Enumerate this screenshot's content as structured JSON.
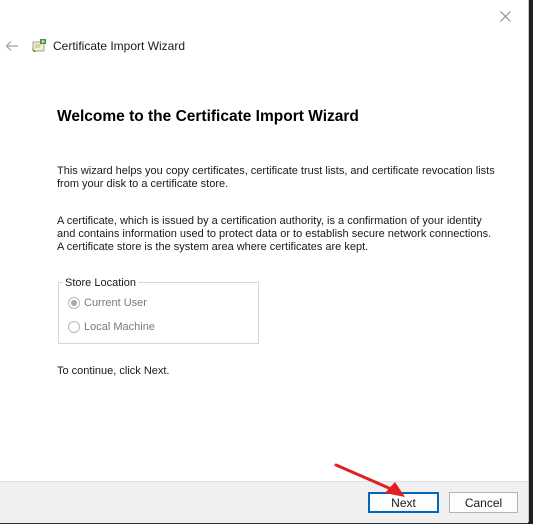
{
  "window": {
    "title": "Certificate Import Wizard"
  },
  "main": {
    "heading": "Welcome to the Certificate Import Wizard",
    "paragraph1": "This wizard helps you copy certificates, certificate trust lists, and certificate revocation lists from your disk to a certificate store.",
    "paragraph2": "A certificate, which is issued by a certification authority, is a confirmation of your identity and contains information used to protect data or to establish secure network connections. A certificate store is the system area where certificates are kept.",
    "store_location": {
      "legend": "Store Location",
      "options": [
        {
          "label": "Current User",
          "checked": true,
          "enabled": false
        },
        {
          "label": "Local Machine",
          "checked": false,
          "enabled": false
        }
      ]
    },
    "continue_text": "To continue, click Next."
  },
  "footer": {
    "next_label": "Next",
    "cancel_label": "Cancel"
  },
  "colors": {
    "accent": "#0067c0",
    "annotation_arrow": "#e02020"
  }
}
